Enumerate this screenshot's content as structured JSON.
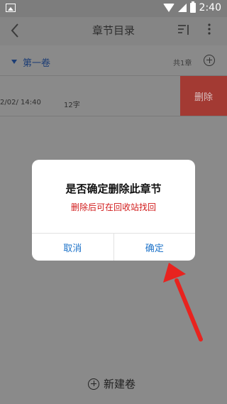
{
  "status_bar": {
    "time": "2:40"
  },
  "toolbar": {
    "title": "章节目录"
  },
  "volume": {
    "name": "第一卷",
    "count": "共1章"
  },
  "chapter": {
    "date": "2/02/ 14:40",
    "words": "12字",
    "delete_label": "删除"
  },
  "footer": {
    "new_volume_label": "新建卷"
  },
  "dialog": {
    "title": "是否确定删除此章节",
    "message": "删除后可在回收站找回",
    "cancel_label": "取消",
    "confirm_label": "确定"
  },
  "colors": {
    "accent_blue": "#1e73c9",
    "warning_red": "#d11a1a",
    "delete_bg": "#a33a33",
    "annotation_arrow": "#e8231f"
  }
}
